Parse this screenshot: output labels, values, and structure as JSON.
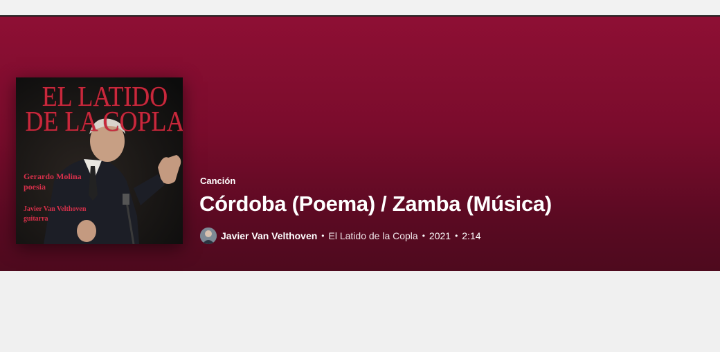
{
  "header": {
    "type_label": "Canción",
    "title": "Córdoba (Poema) / Zamba (Música)"
  },
  "cover": {
    "title_line1": "EL LATIDO",
    "title_line2": "DE LA COPLA",
    "credit1_name": "Gerardo Molina",
    "credit1_role": "poesia",
    "credit2_name": "Javier Van Velthoven",
    "credit2_role": "guitarra"
  },
  "info": {
    "artist": "Javier Van Velthoven",
    "separator": "•",
    "album": "El Latido de la Copla",
    "year": "2021",
    "duration": "2:14"
  },
  "colors": {
    "hero_top": "#8e0f34",
    "hero_bottom": "#4e0a1e",
    "cover_title": "#c8283c"
  }
}
